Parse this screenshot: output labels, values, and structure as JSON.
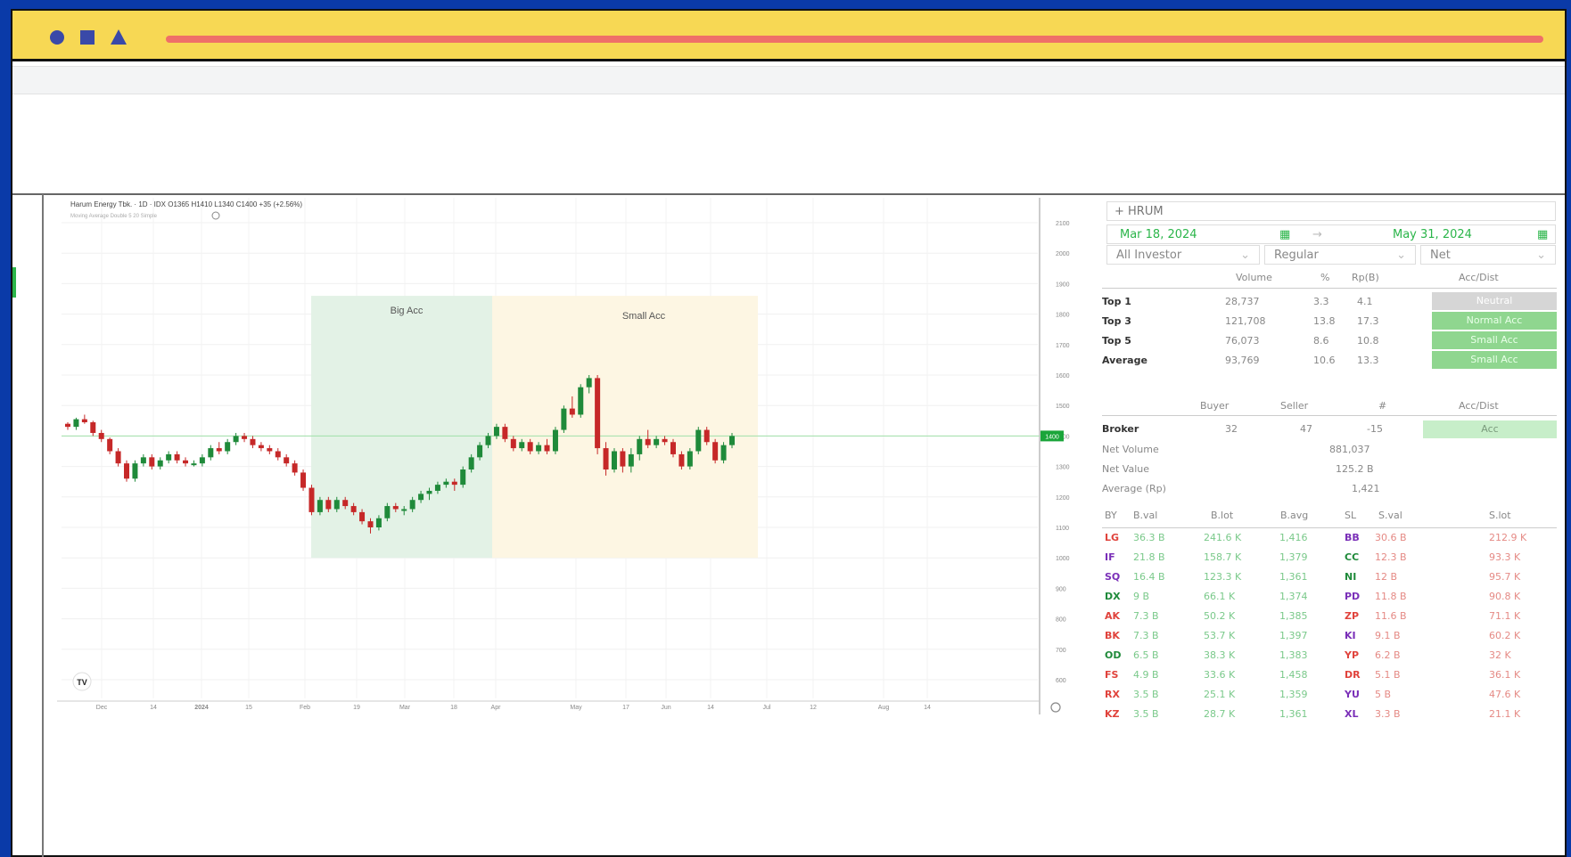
{
  "window": {
    "accent": "#f7d854",
    "progress_color": "#ef6f68"
  },
  "chart_header": {
    "title": "Harum Energy Tbk. · 1D · IDX  O1365 H1410 L1340 C1400 +35 (+2.56%)",
    "indicator": "Moving Average Double 5 20 Simple"
  },
  "chart_data": {
    "type": "candlestick",
    "y_ticks": [
      "2100",
      "2000",
      "1900",
      "1800",
      "1700",
      "1600",
      "1500",
      "1400",
      "1300",
      "1200",
      "1100",
      "1000",
      "900",
      "800",
      "700",
      "600"
    ],
    "x_ticks": [
      "Dec",
      "14",
      "2024",
      "15",
      "Feb",
      "19",
      "Mar",
      "18",
      "Apr",
      "May",
      "17",
      "Jun",
      "14",
      "Jul",
      "12",
      "Aug",
      "14"
    ],
    "last_price": "1400",
    "zones": [
      {
        "label": "Big Acc",
        "color": "#e3f2e6"
      },
      {
        "label": "Small Acc",
        "color": "#fdf6e3"
      }
    ],
    "candles": [
      [
        1440,
        1445,
        1420,
        1430
      ],
      [
        1430,
        1460,
        1420,
        1455
      ],
      [
        1455,
        1470,
        1440,
        1445
      ],
      [
        1445,
        1450,
        1400,
        1410
      ],
      [
        1410,
        1420,
        1380,
        1390
      ],
      [
        1390,
        1395,
        1340,
        1350
      ],
      [
        1350,
        1360,
        1300,
        1310
      ],
      [
        1310,
        1320,
        1250,
        1260
      ],
      [
        1260,
        1320,
        1250,
        1310
      ],
      [
        1310,
        1340,
        1300,
        1330
      ],
      [
        1330,
        1340,
        1290,
        1300
      ],
      [
        1300,
        1330,
        1290,
        1320
      ],
      [
        1320,
        1350,
        1310,
        1340
      ],
      [
        1340,
        1350,
        1310,
        1320
      ],
      [
        1320,
        1330,
        1300,
        1310
      ],
      [
        1310,
        1320,
        1300,
        1310
      ],
      [
        1310,
        1340,
        1300,
        1330
      ],
      [
        1330,
        1370,
        1320,
        1360
      ],
      [
        1360,
        1380,
        1340,
        1350
      ],
      [
        1350,
        1390,
        1340,
        1380
      ],
      [
        1380,
        1410,
        1370,
        1400
      ],
      [
        1400,
        1410,
        1380,
        1390
      ],
      [
        1390,
        1400,
        1360,
        1370
      ],
      [
        1370,
        1380,
        1350,
        1360
      ],
      [
        1360,
        1370,
        1340,
        1350
      ],
      [
        1350,
        1360,
        1320,
        1330
      ],
      [
        1330,
        1340,
        1300,
        1310
      ],
      [
        1310,
        1320,
        1270,
        1280
      ],
      [
        1280,
        1290,
        1220,
        1230
      ],
      [
        1230,
        1240,
        1140,
        1150
      ],
      [
        1150,
        1200,
        1140,
        1190
      ],
      [
        1190,
        1200,
        1150,
        1160
      ],
      [
        1160,
        1200,
        1150,
        1190
      ],
      [
        1190,
        1200,
        1160,
        1170
      ],
      [
        1170,
        1180,
        1140,
        1150
      ],
      [
        1150,
        1160,
        1110,
        1120
      ],
      [
        1120,
        1130,
        1080,
        1100
      ],
      [
        1100,
        1140,
        1090,
        1130
      ],
      [
        1130,
        1180,
        1120,
        1170
      ],
      [
        1170,
        1180,
        1150,
        1160
      ],
      [
        1160,
        1170,
        1140,
        1160
      ],
      [
        1160,
        1200,
        1150,
        1190
      ],
      [
        1190,
        1220,
        1180,
        1210
      ],
      [
        1210,
        1230,
        1190,
        1220
      ],
      [
        1220,
        1250,
        1210,
        1240
      ],
      [
        1240,
        1260,
        1230,
        1250
      ],
      [
        1250,
        1260,
        1220,
        1240
      ],
      [
        1240,
        1300,
        1230,
        1290
      ],
      [
        1290,
        1340,
        1280,
        1330
      ],
      [
        1330,
        1380,
        1320,
        1370
      ],
      [
        1370,
        1410,
        1360,
        1400
      ],
      [
        1400,
        1440,
        1390,
        1430
      ],
      [
        1430,
        1440,
        1380,
        1390
      ],
      [
        1390,
        1400,
        1350,
        1360
      ],
      [
        1360,
        1390,
        1350,
        1380
      ],
      [
        1380,
        1390,
        1340,
        1350
      ],
      [
        1350,
        1380,
        1340,
        1370
      ],
      [
        1370,
        1390,
        1340,
        1350
      ],
      [
        1350,
        1430,
        1340,
        1420
      ],
      [
        1420,
        1500,
        1410,
        1490
      ],
      [
        1490,
        1530,
        1460,
        1470
      ],
      [
        1470,
        1570,
        1460,
        1560
      ],
      [
        1560,
        1600,
        1540,
        1590
      ],
      [
        1590,
        1600,
        1340,
        1360
      ],
      [
        1360,
        1380,
        1270,
        1290
      ],
      [
        1290,
        1360,
        1280,
        1350
      ],
      [
        1350,
        1360,
        1280,
        1300
      ],
      [
        1300,
        1360,
        1280,
        1340
      ],
      [
        1340,
        1400,
        1320,
        1390
      ],
      [
        1390,
        1420,
        1360,
        1370
      ],
      [
        1370,
        1400,
        1360,
        1390
      ],
      [
        1390,
        1400,
        1370,
        1380
      ],
      [
        1380,
        1390,
        1330,
        1340
      ],
      [
        1340,
        1350,
        1290,
        1300
      ],
      [
        1300,
        1360,
        1290,
        1350
      ],
      [
        1350,
        1430,
        1340,
        1420
      ],
      [
        1420,
        1430,
        1370,
        1380
      ],
      [
        1380,
        1390,
        1310,
        1320
      ],
      [
        1320,
        1380,
        1310,
        1370
      ],
      [
        1370,
        1410,
        1360,
        1400
      ]
    ]
  },
  "panel": {
    "symbol": "+ HRUM",
    "date_from": "Mar 18, 2024",
    "arrow": "→",
    "date_to": "May 31, 2024",
    "select_investor": "All Investor",
    "select_market": "Regular",
    "select_mode": "Net",
    "summary_headers": [
      "Volume",
      "%",
      "Rp(B)",
      "Acc/Dist"
    ],
    "summary": [
      {
        "label": "Top 1",
        "volume": "28,737",
        "pct": "3.3",
        "rp": "4.1",
        "status": "Neutral"
      },
      {
        "label": "Top 3",
        "volume": "121,708",
        "pct": "13.8",
        "rp": "17.3",
        "status": "Normal Acc"
      },
      {
        "label": "Top 5",
        "volume": "76,073",
        "pct": "8.6",
        "rp": "10.8",
        "status": "Small Acc"
      },
      {
        "label": "Average",
        "volume": "93,769",
        "pct": "10.6",
        "rp": "13.3",
        "status": "Small Acc"
      }
    ],
    "broker_headers": [
      "Buyer",
      "Seller",
      "#",
      "Acc/Dist"
    ],
    "broker": {
      "label": "Broker",
      "buyer": "32",
      "seller": "47",
      "count": "-15",
      "status": "Acc"
    },
    "net_volume": {
      "label": "Net Volume",
      "value": "881,037"
    },
    "net_value": {
      "label": "Net Value",
      "value": "125.2 B"
    },
    "average_rp": {
      "label": "Average (Rp)",
      "value": "1,421"
    },
    "table_headers": [
      "BY",
      "B.val",
      "B.lot",
      "B.avg",
      "SL",
      "S.val",
      "S.lot"
    ],
    "rows": [
      {
        "by": "LG",
        "by_c": "#e0433c",
        "bval": "36.3 B",
        "blot": "241.6 K",
        "bavg": "1,416",
        "sl": "BB",
        "sl_c": "#7a2fb8",
        "sval": "30.6 B",
        "slot": "212.9 K"
      },
      {
        "by": "IF",
        "by_c": "#7a2fb8",
        "bval": "21.8 B",
        "blot": "158.7 K",
        "bavg": "1,379",
        "sl": "CC",
        "sl_c": "#1f8a3a",
        "sval": "12.3 B",
        "slot": "93.3 K"
      },
      {
        "by": "SQ",
        "by_c": "#7a2fb8",
        "bval": "16.4 B",
        "blot": "123.3 K",
        "bavg": "1,361",
        "sl": "NI",
        "sl_c": "#1f8a3a",
        "sval": "12 B",
        "slot": "95.7 K"
      },
      {
        "by": "DX",
        "by_c": "#1f8a3a",
        "bval": "9 B",
        "blot": "66.1 K",
        "bavg": "1,374",
        "sl": "PD",
        "sl_c": "#7a2fb8",
        "sval": "11.8 B",
        "slot": "90.8 K"
      },
      {
        "by": "AK",
        "by_c": "#e0433c",
        "bval": "7.3 B",
        "blot": "50.2 K",
        "bavg": "1,385",
        "sl": "ZP",
        "sl_c": "#e0433c",
        "sval": "11.6 B",
        "slot": "71.1 K"
      },
      {
        "by": "BK",
        "by_c": "#e0433c",
        "bval": "7.3 B",
        "blot": "53.7 K",
        "bavg": "1,397",
        "sl": "KI",
        "sl_c": "#7a2fb8",
        "sval": "9.1 B",
        "slot": "60.2 K"
      },
      {
        "by": "OD",
        "by_c": "#1f8a3a",
        "bval": "6.5 B",
        "blot": "38.3 K",
        "bavg": "1,383",
        "sl": "YP",
        "sl_c": "#e0433c",
        "sval": "6.2 B",
        "slot": "32 K"
      },
      {
        "by": "FS",
        "by_c": "#e0433c",
        "bval": "4.9 B",
        "blot": "33.6 K",
        "bavg": "1,458",
        "sl": "DR",
        "sl_c": "#e0433c",
        "sval": "5.1 B",
        "slot": "36.1 K"
      },
      {
        "by": "RX",
        "by_c": "#e0433c",
        "bval": "3.5 B",
        "blot": "25.1 K",
        "bavg": "1,359",
        "sl": "YU",
        "sl_c": "#7a2fb8",
        "sval": "5 B",
        "slot": "47.6 K"
      },
      {
        "by": "KZ",
        "by_c": "#e0433c",
        "bval": "3.5 B",
        "blot": "28.7 K",
        "bavg": "1,361",
        "sl": "XL",
        "sl_c": "#7a2fb8",
        "sval": "3.3 B",
        "slot": "21.1 K"
      }
    ]
  }
}
